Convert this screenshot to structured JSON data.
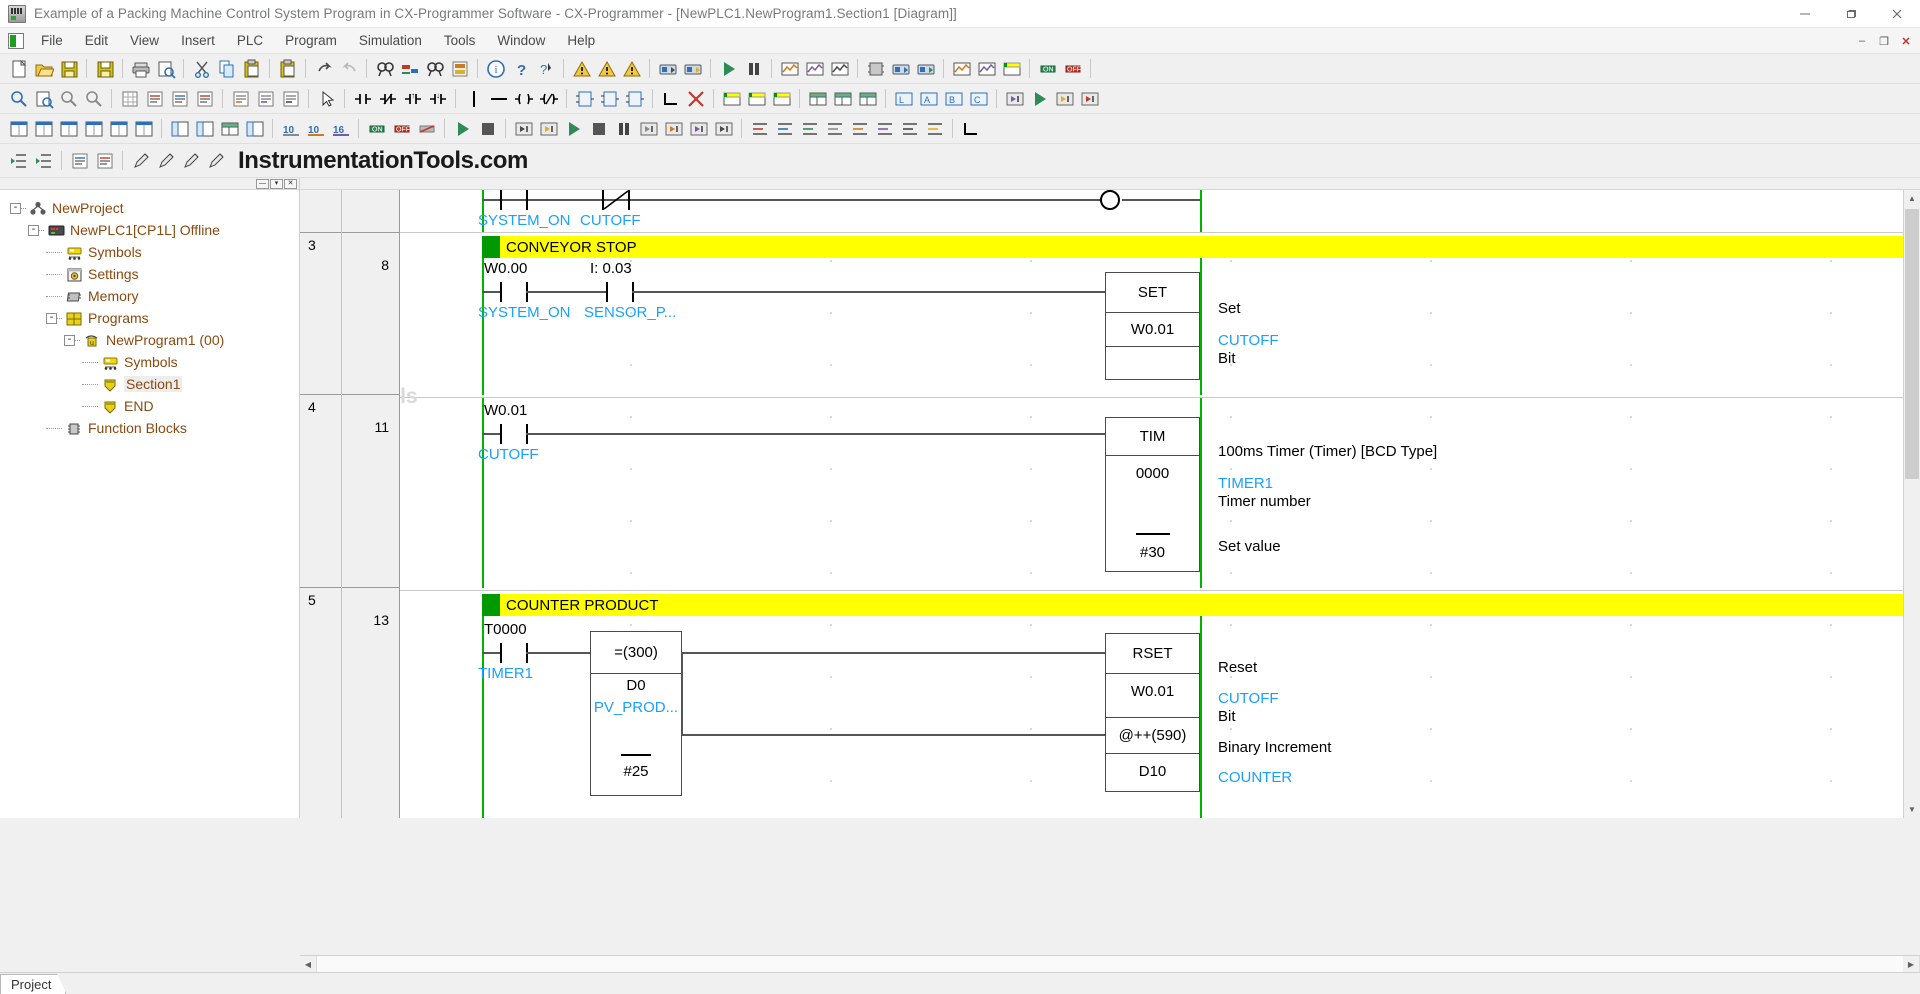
{
  "window": {
    "title": "Example of a Packing Machine Control System Program in CX-Programmer Software - CX-Programmer - [NewPLC1.NewProgram1.Section1 [Diagram]]",
    "minimize": "—",
    "maximize": "❐",
    "close": "✕",
    "mdi_minimize": "–",
    "mdi_restore": "❐",
    "mdi_close": "✕"
  },
  "menu": {
    "items": [
      {
        "label": "File"
      },
      {
        "label": "Edit"
      },
      {
        "label": "View"
      },
      {
        "label": "Insert"
      },
      {
        "label": "PLC"
      },
      {
        "label": "Program"
      },
      {
        "label": "Simulation"
      },
      {
        "label": "Tools"
      },
      {
        "label": "Window"
      },
      {
        "label": "Help"
      }
    ]
  },
  "brand": {
    "text": "InstrumentationTools.com"
  },
  "toolbar_rows": {
    "row1": [
      "new-file-icon",
      "open-file-icon",
      "save-icon",
      "sep",
      "save-plc-icon",
      "sep",
      "print-icon",
      "print-preview-icon",
      "sep",
      "cut-icon",
      "copy-icon",
      "paste-icon",
      "sep",
      "paste-special-icon",
      "sep",
      "undo-icon",
      "redo-icon",
      "sep",
      "find-icon",
      "replace-icon",
      "search-symbol-icon",
      "compare-icon",
      "sep",
      "info-icon",
      "help-icon",
      "help-arrow-icon",
      "sep",
      "error-icon",
      "compile-icon",
      "compile-all-icon",
      "sep",
      "transfer-to-plc-icon",
      "transfer-from-plc-icon",
      "sep",
      "run-mode-icon",
      "pause-icon",
      "sep",
      "monitor-icon",
      "differential-monitor-icon",
      "data-trace-icon",
      "sep",
      "memory-icon",
      "io-table-icon",
      "plc-setup-icon",
      "sep",
      "clock-icon",
      "time-chart-icon",
      "online-edit-icon",
      "sep",
      "force-set-icon",
      "force-reset-icon",
      "sep"
    ],
    "row2": [
      "zoom-in-icon",
      "zoom-find-icon",
      "zoom-out-icon",
      "zoom-reset-icon",
      "sep",
      "grid-icon",
      "comment-list-icon",
      "symbol-list-icon",
      "section-list-icon",
      "sep",
      "mnemonic-icon",
      "address-ref-icon",
      "cross-ref-icon",
      "sep",
      "select-icon",
      "sep",
      "contact-no-icon",
      "contact-nc-icon",
      "contact-diff-up-icon",
      "contact-diff-down-icon",
      "sep",
      "vertical-line-icon",
      "horizontal-line-icon",
      "coil-icon",
      "coil-neg-icon",
      "sep",
      "instruction-icon",
      "function-block-icon",
      "fb-param-icon",
      "sep",
      "corner-icon",
      "delete-line-icon",
      "sep",
      "new-rung-icon",
      "insert-rung-icon",
      "rung-comment-icon",
      "sep",
      "watch-icon",
      "watch-add-icon",
      "watch-del-icon",
      "sep",
      "pll-icon",
      "pll-a-icon",
      "pll-b-icon",
      "pll-c-icon",
      "sep",
      "simulator-icon",
      "step-run-icon",
      "step-in-icon",
      "step-out-icon"
    ],
    "row3": [
      "window-tile-icon",
      "window-cascade-icon",
      "window-h-icon",
      "window-v-icon",
      "window-new-icon",
      "window-close-icon",
      "sep",
      "project-tree-icon",
      "output-win-icon",
      "watch-win-icon",
      "address-win-icon",
      "sep",
      "base10-icon",
      "base10b-icon",
      "base16-icon",
      "sep",
      "force-on-icon",
      "force-off-icon",
      "force-cancel-icon",
      "sep",
      "sim-run-icon",
      "sim-stop-icon",
      "sep",
      "task-icon",
      "task2-icon",
      "play-icon",
      "stop-icon",
      "pause2-icon",
      "step-icon",
      "scan-icon",
      "fast-icon",
      "end-icon",
      "sep",
      "align-a-icon",
      "align-b-icon",
      "align-c-icon",
      "align-d-icon",
      "align-e-icon",
      "align-f-icon",
      "align-g-icon",
      "align-h-icon",
      "sep",
      "corner2-icon"
    ],
    "row4": [
      "indent-in-icon",
      "indent-out-icon",
      "sep",
      "list-a-icon",
      "list-b-icon",
      "sep",
      "pen-a-icon",
      "pen-b-icon",
      "pen-c-icon",
      "pen-d-icon"
    ]
  },
  "project_tree": {
    "items": [
      {
        "label": "NewProject",
        "icon": "project-icon",
        "depth": 0,
        "expander": "-",
        "selected": false
      },
      {
        "label": "NewPLC1[CP1L] Offline",
        "icon": "plc-icon",
        "depth": 1,
        "expander": "-",
        "selected": false
      },
      {
        "label": "Symbols",
        "icon": "symbols-icon",
        "depth": 2,
        "expander": "",
        "selected": false
      },
      {
        "label": "Settings",
        "icon": "settings-icon",
        "depth": 2,
        "expander": "",
        "selected": false
      },
      {
        "label": "Memory",
        "icon": "memory-icon",
        "depth": 2,
        "expander": "",
        "selected": false
      },
      {
        "label": "Programs",
        "icon": "programs-icon",
        "depth": 2,
        "expander": "-",
        "selected": false
      },
      {
        "label": "NewProgram1 (00)",
        "icon": "program-icon",
        "depth": 3,
        "expander": "-",
        "selected": false
      },
      {
        "label": "Symbols",
        "icon": "symbols-icon",
        "depth": 4,
        "expander": "",
        "selected": false
      },
      {
        "label": "Section1",
        "icon": "section-icon",
        "depth": 4,
        "expander": "",
        "selected": true
      },
      {
        "label": "END",
        "icon": "section-icon",
        "depth": 4,
        "expander": "",
        "selected": false
      },
      {
        "label": "Function Blocks",
        "icon": "function-blocks-icon",
        "depth": 2,
        "expander": "",
        "selected": false
      }
    ]
  },
  "ladder": {
    "rungs": [
      {
        "number": "",
        "step": "",
        "comment": null,
        "contacts": [
          {
            "addr": "SYSTEM_ON",
            "sym": "SYSTEM_ON",
            "type": "no",
            "addr_hidden": true
          },
          {
            "addr": "CUTOFF",
            "sym": "CUTOFF",
            "type": "nc",
            "addr_hidden": true
          }
        ],
        "coil": true
      },
      {
        "number": "3",
        "step": "8",
        "comment": "CONVEYOR STOP",
        "contacts": [
          {
            "addr": "W0.00",
            "sym": "SYSTEM_ON",
            "type": "no"
          },
          {
            "addr": "I: 0.03",
            "sym": "SENSOR_P...",
            "type": "no"
          }
        ],
        "instruction": {
          "name": "SET",
          "operands": [
            "W0.01"
          ],
          "desc": [
            "Set"
          ],
          "op_sym": [
            "CUTOFF"
          ],
          "op_role": [
            "Bit"
          ]
        }
      },
      {
        "number": "4",
        "step": "11",
        "comment": null,
        "contacts": [
          {
            "addr": "W0.01",
            "sym": "CUTOFF",
            "type": "no"
          }
        ],
        "instruction": {
          "name": "TIM",
          "operands": [
            "0000",
            "#30"
          ],
          "desc": [
            "100ms Timer (Timer) [BCD Type]"
          ],
          "op_sym": [
            "TIMER1",
            ""
          ],
          "op_role": [
            "Timer number",
            "Set value"
          ]
        }
      },
      {
        "number": "5",
        "step": "13",
        "comment": "COUNTER PRODUCT",
        "contacts": [
          {
            "addr": "T0000",
            "sym": "TIMER1",
            "type": "no"
          }
        ],
        "compare": {
          "name": "=(300)",
          "operands": [
            "D0",
            "#25"
          ],
          "op_sym": [
            "PV_PROD...",
            ""
          ]
        },
        "branches": [
          {
            "instruction": {
              "name": "RSET",
              "operands": [
                "W0.01"
              ],
              "desc": [
                "Reset"
              ],
              "op_sym": [
                "CUTOFF"
              ],
              "op_role": [
                "Bit"
              ]
            }
          },
          {
            "instruction": {
              "name": "@++(590)",
              "operands": [
                "D10"
              ],
              "desc": [
                "Binary Increment"
              ],
              "op_sym": [
                "COUNTER"
              ],
              "op_role": [
                ""
              ]
            }
          }
        ]
      }
    ],
    "watermark": "Inst Tools"
  },
  "statusbar": {
    "tab": "Project"
  },
  "colors": {
    "symbol_blue": "#1aa0ff",
    "rung_comment_bg": "#ffff00",
    "rung_comment_marker": "#009900",
    "rail_green": "#00b400",
    "tree_text": "#8a4a10",
    "title_text": "#777a7d"
  }
}
